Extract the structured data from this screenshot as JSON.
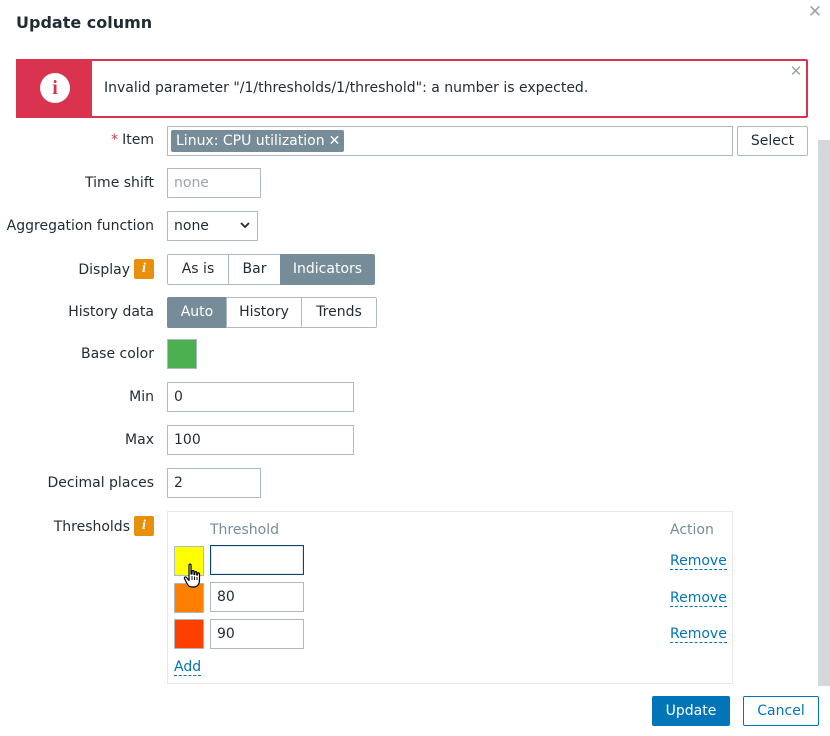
{
  "dialog": {
    "title": "Update column",
    "close_icon": "close-icon"
  },
  "error": {
    "icon": "info-circle-icon",
    "icon_glyph": "i",
    "message": "Invalid parameter \"/1/thresholds/1/threshold\": a number is expected.",
    "close_icon": "close-icon"
  },
  "form": {
    "item": {
      "label": "Item",
      "required_mark": "*",
      "tag": "Linux: CPU utilization",
      "tag_remove": "✕",
      "select_label": "Select"
    },
    "time_shift": {
      "label": "Time shift",
      "placeholder": "none",
      "value": ""
    },
    "aggregation": {
      "label": "Aggregation function",
      "value": "none"
    },
    "display": {
      "label": "Display",
      "info_glyph": "i",
      "options": [
        "As is",
        "Bar",
        "Indicators"
      ],
      "selected": "Indicators"
    },
    "history": {
      "label": "History data",
      "options": [
        "Auto",
        "History",
        "Trends"
      ],
      "selected": "Auto"
    },
    "base_color": {
      "label": "Base color",
      "color": "#4caf50"
    },
    "min": {
      "label": "Min",
      "value": "0"
    },
    "max": {
      "label": "Max",
      "value": "100"
    },
    "decimal_places": {
      "label": "Decimal places",
      "value": "2"
    },
    "thresholds": {
      "label": "Thresholds",
      "info_glyph": "i",
      "col_threshold": "Threshold",
      "col_action": "Action",
      "rows": [
        {
          "color": "#ffff00",
          "value": "",
          "remove": "Remove"
        },
        {
          "color": "#ff8000",
          "value": "80",
          "remove": "Remove"
        },
        {
          "color": "#ff4000",
          "value": "90",
          "remove": "Remove"
        }
      ],
      "add_label": "Add"
    }
  },
  "footer": {
    "update_label": "Update",
    "cancel_label": "Cancel"
  },
  "colors": {
    "error_accent": "#d9334f",
    "primary": "#0275b8",
    "segment_active": "#768d99",
    "info_icon": "#e8900c"
  }
}
